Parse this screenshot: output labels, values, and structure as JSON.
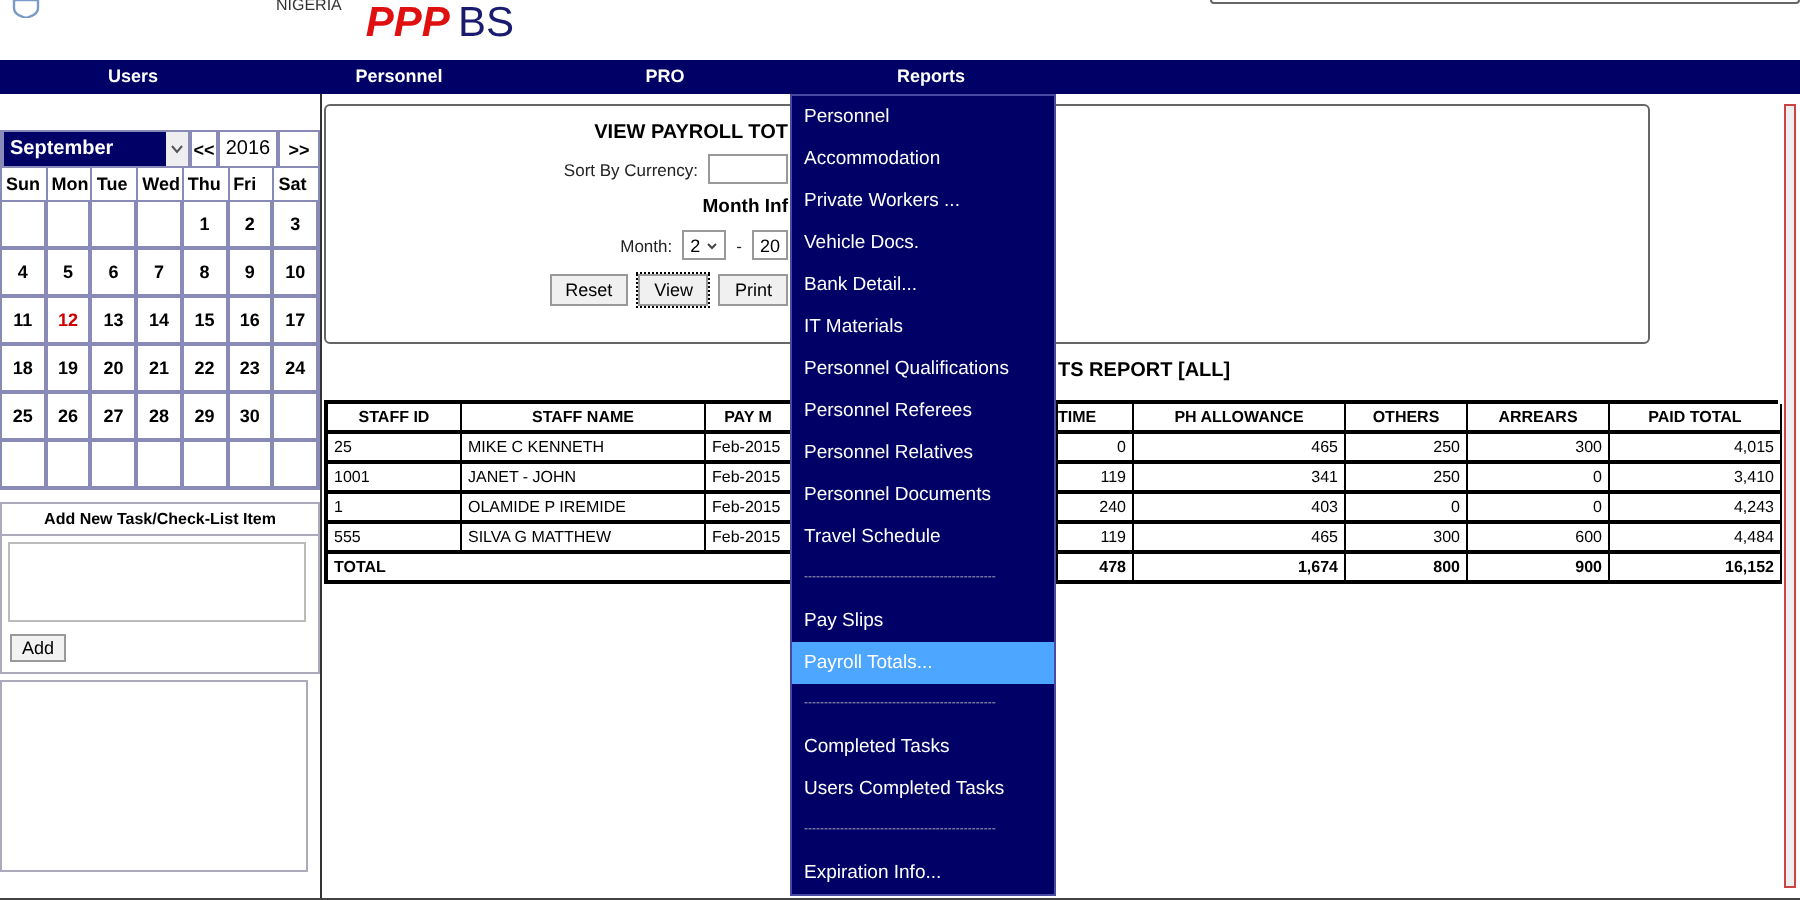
{
  "header": {
    "country": "NIGERIA",
    "logo_red": "PPP",
    "logo_blue": "BS"
  },
  "nav": [
    {
      "label": "Users"
    },
    {
      "label": "Personnel"
    },
    {
      "label": "PRO"
    },
    {
      "label": "Reports"
    }
  ],
  "calendar": {
    "month": "September",
    "prev": "<<",
    "year": "2016",
    "next": ">>",
    "weekdays": [
      "Sun",
      "Mon",
      "Tue",
      "Wed",
      "Thu",
      "Fri",
      "Sat"
    ],
    "weeks": [
      [
        {
          "day": "1",
          "today": false
        },
        {
          "day": "2",
          "today": false
        },
        {
          "day": "3",
          "today": false
        }
      ],
      [
        {
          "day": "4",
          "today": false
        },
        {
          "day": "5",
          "today": false
        },
        {
          "day": "6",
          "today": false
        },
        {
          "day": "7",
          "today": false
        },
        {
          "day": "8",
          "today": false
        },
        {
          "day": "9",
          "today": false
        },
        {
          "day": "10",
          "today": false
        }
      ],
      [
        {
          "day": "11",
          "today": false
        },
        {
          "day": "12",
          "today": true
        },
        {
          "day": "13",
          "today": false
        },
        {
          "day": "14",
          "today": false
        },
        {
          "day": "15",
          "today": false
        },
        {
          "day": "16",
          "today": false
        },
        {
          "day": "17",
          "today": false
        }
      ],
      [
        {
          "day": "18",
          "today": false
        },
        {
          "day": "19",
          "today": false
        },
        {
          "day": "20",
          "today": false
        },
        {
          "day": "21",
          "today": false
        },
        {
          "day": "22",
          "today": false
        },
        {
          "day": "23",
          "today": false
        },
        {
          "day": "24",
          "today": false
        }
      ],
      [
        {
          "day": "25",
          "today": false
        },
        {
          "day": "26",
          "today": false
        },
        {
          "day": "27",
          "today": false
        },
        {
          "day": "28",
          "today": false
        },
        {
          "day": "29",
          "today": false
        },
        {
          "day": "30",
          "today": false
        }
      ]
    ]
  },
  "task": {
    "title": "Add New Task/Check-List Item",
    "button": "Add"
  },
  "form": {
    "title": "VIEW PAYROLL TOT",
    "currency_label": "Sort By Currency:",
    "section": "Month Inf",
    "month_label": "Month:",
    "month": "2",
    "dash": "-",
    "year": "20",
    "buttons": [
      "Reset",
      "View",
      "Print"
    ]
  },
  "report_title": "TS REPORT [ALL]",
  "table": {
    "columns": [
      "STAFF ID",
      "STAFF NAME",
      "PAY M",
      "TIME",
      "PH ALLOWANCE",
      "OTHERS",
      "ARREARS",
      "PAID TOTAL"
    ],
    "rows": [
      [
        "25",
        "MIKE C KENNETH",
        "Feb-2015",
        "0",
        "465",
        "250",
        "300",
        "4,015"
      ],
      [
        "1001",
        "JANET - JOHN",
        "Feb-2015",
        "119",
        "341",
        "250",
        "0",
        "3,410"
      ],
      [
        "1",
        "OLAMIDE P IREMIDE",
        "Feb-2015",
        "240",
        "403",
        "0",
        "0",
        "4,243"
      ],
      [
        "555",
        "SILVA G MATTHEW",
        "Feb-2015",
        "119",
        "465",
        "300",
        "600",
        "4,484"
      ]
    ],
    "total": {
      "label": "TOTAL",
      "values": [
        "478",
        "1,674",
        "800",
        "900",
        "16,152"
      ]
    }
  },
  "menu": [
    {
      "kind": "item",
      "label": "Personnel",
      "selected": false
    },
    {
      "kind": "item",
      "label": "Accommodation",
      "selected": false
    },
    {
      "kind": "item",
      "label": "Private Workers ...",
      "selected": false
    },
    {
      "kind": "item",
      "label": "Vehicle Docs.",
      "selected": false
    },
    {
      "kind": "item",
      "label": "Bank Detail...",
      "selected": false
    },
    {
      "kind": "item",
      "label": "IT Materials",
      "selected": false
    },
    {
      "kind": "item",
      "label": "Personnel Qualifications",
      "selected": false
    },
    {
      "kind": "item",
      "label": "Personnel Referees",
      "selected": false
    },
    {
      "kind": "item",
      "label": "Personnel Relatives",
      "selected": false
    },
    {
      "kind": "item",
      "label": "Personnel Documents",
      "selected": false
    },
    {
      "kind": "item",
      "label": "Travel Schedule",
      "selected": false
    },
    {
      "kind": "separator",
      "label": "------------------------------------------------"
    },
    {
      "kind": "item",
      "label": "Pay Slips",
      "selected": false
    },
    {
      "kind": "item",
      "label": "Payroll Totals...",
      "selected": true
    },
    {
      "kind": "separator",
      "label": "------------------------------------------------"
    },
    {
      "kind": "item",
      "label": "Completed Tasks",
      "selected": false
    },
    {
      "kind": "item",
      "label": "Users Completed Tasks",
      "selected": false
    },
    {
      "kind": "separator",
      "label": "------------------------------------------------"
    },
    {
      "kind": "item",
      "label": "Expiration Info...",
      "selected": false
    }
  ]
}
